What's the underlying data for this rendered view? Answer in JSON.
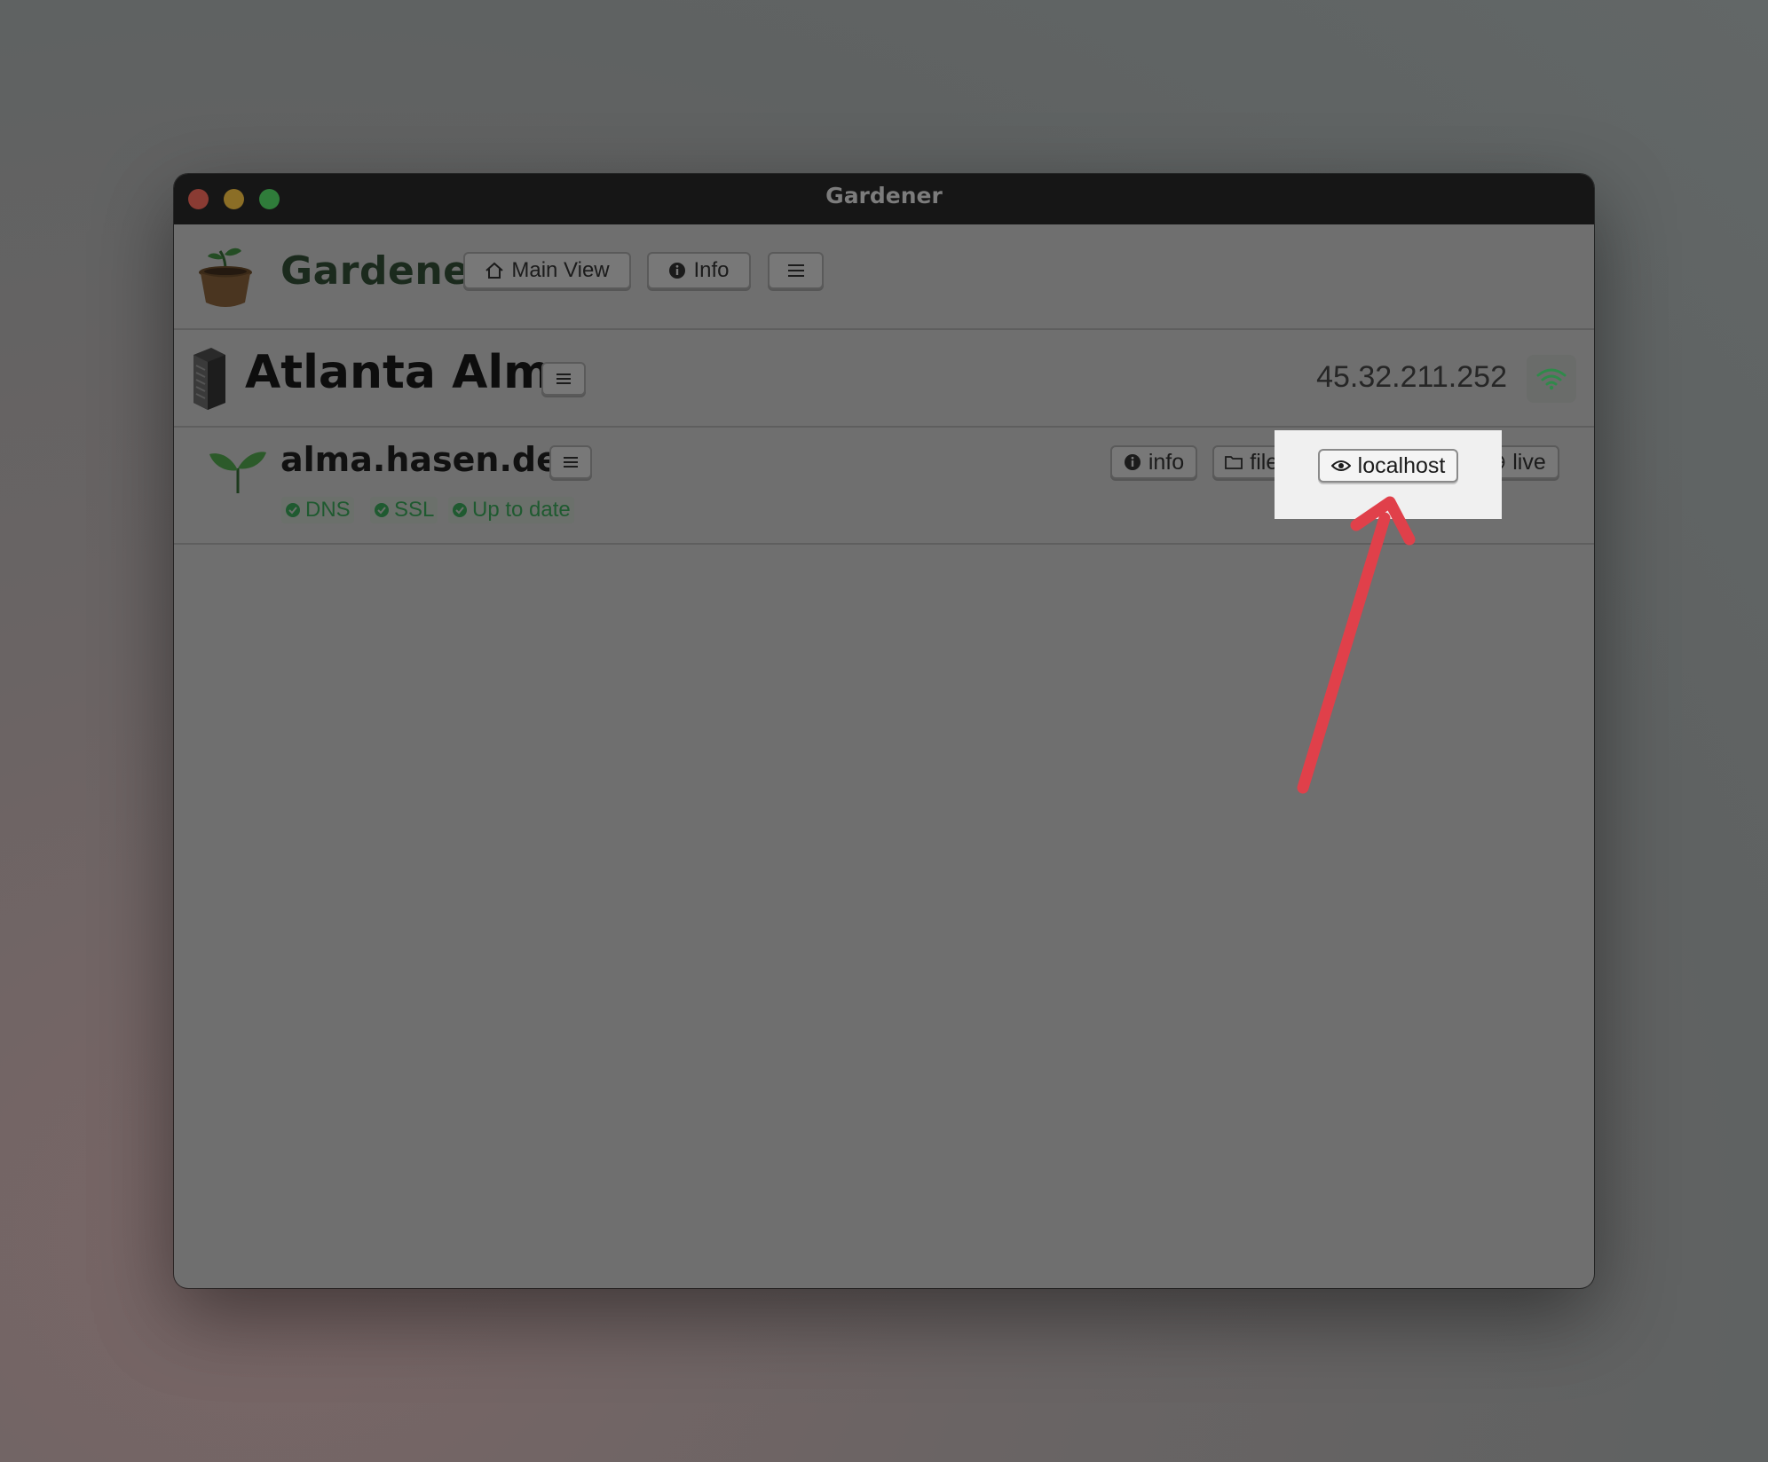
{
  "window": {
    "title": "Gardener"
  },
  "app": {
    "name": "Gardener",
    "logo_icon": "plant-pot-icon",
    "toolbar": {
      "main_view_label": "Main View",
      "info_label": "Info",
      "menu_icon": "hamburger-icon"
    }
  },
  "server": {
    "name": "Atlanta Alma",
    "icon": "server-rack-icon",
    "ip": "45.32.211.252",
    "status_icon": "wifi-icon",
    "status_color": "#2f8a4a"
  },
  "site": {
    "domain": "alma.hasen.dev",
    "icon": "sprout-icon",
    "badges": [
      {
        "label": "DNS",
        "icon": "check-circle-icon"
      },
      {
        "label": "SSL",
        "icon": "check-circle-icon"
      },
      {
        "label": "Up to date",
        "icon": "check-circle-icon"
      }
    ],
    "actions": {
      "info_label": "info",
      "files_label": "files",
      "localhost_label": "localhost",
      "live_label": "live"
    }
  },
  "annotation": {
    "arrow_color": "#e0404a",
    "highlight_target": "localhost"
  }
}
